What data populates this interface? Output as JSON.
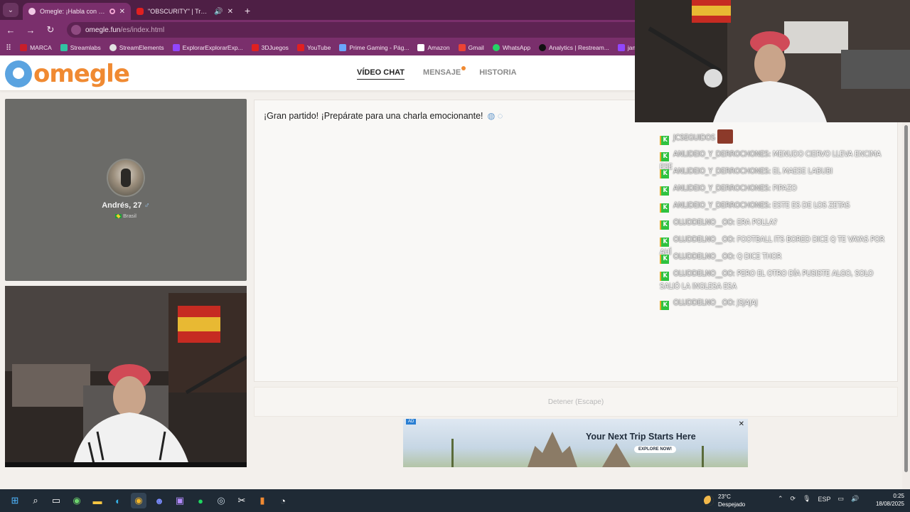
{
  "browser": {
    "tabs": [
      {
        "title": "Omegle: ¡Habla con Descon",
        "active": true
      },
      {
        "title": "\"OBSCURITY\" | Trap Type Be",
        "active": false
      }
    ],
    "url_host": "omegle.fun",
    "url_path": "/es/index.html",
    "bookmarks": [
      {
        "label": "MARCA",
        "color": "#c81e2a"
      },
      {
        "label": "Streamlabs",
        "color": "#31c3a2"
      },
      {
        "label": "StreamElements",
        "color": "#e2e2e2"
      },
      {
        "label": "ExplorarExplorarExp...",
        "color": "#9146ff"
      },
      {
        "label": "3DJuegos",
        "color": "#e02020"
      },
      {
        "label": "YouTube",
        "color": "#e02020"
      },
      {
        "label": "Prime Gaming - Pág...",
        "color": "#6aa6ff"
      },
      {
        "label": "Amazon",
        "color": "#ffffff"
      },
      {
        "label": "Gmail",
        "color": "#ea4335"
      },
      {
        "label": "WhatsApp",
        "color": "#25d366"
      },
      {
        "label": "Analytics | Restream...",
        "color": "#111111"
      },
      {
        "label": "jamonakotv - T",
        "color": "#9146ff"
      }
    ]
  },
  "site": {
    "logo_text": "omegle",
    "nav": [
      {
        "label": "VÍDEO CHAT",
        "active": true,
        "dot": false
      },
      {
        "label": "MENSAJE",
        "active": false,
        "dot": true
      },
      {
        "label": "HISTORIA",
        "active": false,
        "dot": false
      }
    ]
  },
  "stranger": {
    "name": "Andrés, 27",
    "gender_symbol": "♂",
    "country": "Brasil"
  },
  "chat": {
    "message": "¡Gran partido! ¡Prepárate para una charla emocionante!",
    "stop_label": "Detener (Escape)"
  },
  "ad": {
    "tag": "AD",
    "headline": "Your Next Trip Starts Here",
    "cta": "EXPLORE NOW!"
  },
  "stream_chat": [
    {
      "user": "JCSEGUIDOS",
      "text": "",
      "emote": true
    },
    {
      "user": "ANLIDEIO_Y_DERROCHONES:",
      "text": "MENUDO CIERVO LLEVA ENCIMA ESE"
    },
    {
      "user": "ANLIDEIO_Y_DERROCHONES:",
      "text": "EL MAESE LABUBI"
    },
    {
      "user": "ANLIDEIO_Y_DERROCHONES:",
      "text": "PIPAZO"
    },
    {
      "user": "ANLIDEIO_Y_DERROCHONES:",
      "text": "ESTE ES DE LOS ZETAS"
    },
    {
      "user": "OLUDDELNO__OO:",
      "text": "ERA POLLA?"
    },
    {
      "user": "OLUDDELNO__OO:",
      "text": "FOOTBALL ITS BORED DICE Q TE VAYAS POR AHÍ"
    },
    {
      "user": "OLUDDELNO__OO:",
      "text": "Q DICE THOR"
    },
    {
      "user": "OLUDDELNO__OO:",
      "text": "PERO EL OTRO DÍA PUSISTE ALGO, SOLO SALIÓ LA INGLESA ESA"
    },
    {
      "user": "OLUDDELNO__OO:",
      "text": "JSJAJAJ"
    }
  ],
  "taskbar": {
    "weather_temp": "23°C",
    "weather_desc": "Despejado",
    "lang": "ESP",
    "time": "0:25",
    "date": "18/08/2025"
  }
}
